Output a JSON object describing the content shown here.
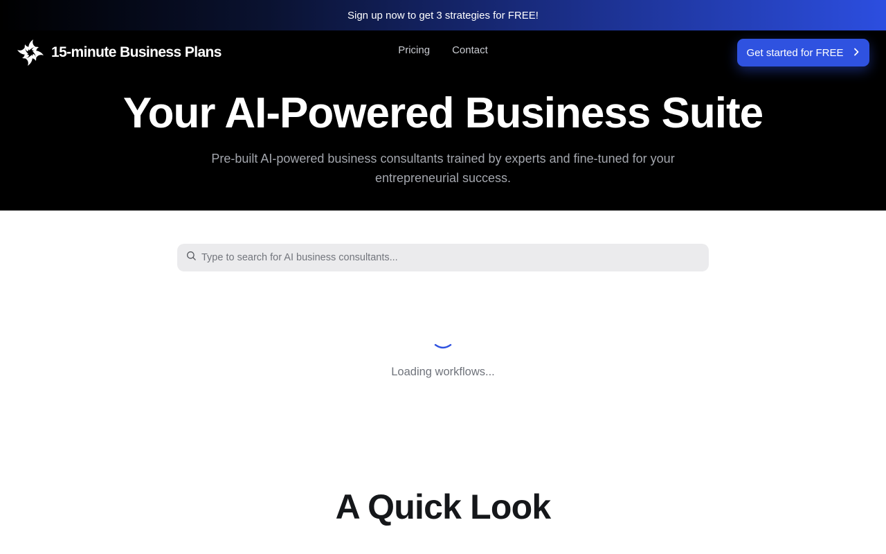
{
  "promo": {
    "text": "Sign up now to get 3 strategies for FREE!"
  },
  "header": {
    "logo_text": "15-minute Business Plans",
    "logo_icon": "pinwheel-logo-icon",
    "nav": [
      {
        "label": "Pricing"
      },
      {
        "label": "Contact"
      }
    ],
    "cta_label": "Get started for FREE",
    "cta_icon": "chevron-right-icon"
  },
  "hero": {
    "title": "Your AI-Powered Business Suite",
    "subtitle": "Pre-built AI-powered business consultants trained by experts and fine-tuned for your entrepreneurial success."
  },
  "search": {
    "placeholder": "Type to search for AI business consultants...",
    "value": "",
    "icon": "search-icon"
  },
  "loading": {
    "text": "Loading workflows...",
    "icon": "loading-spinner-icon"
  },
  "quick_look": {
    "title": "A Quick Look"
  },
  "colors": {
    "accent": "#2f52e0",
    "hero_bg": "#000000",
    "search_bg": "#ebebed"
  }
}
